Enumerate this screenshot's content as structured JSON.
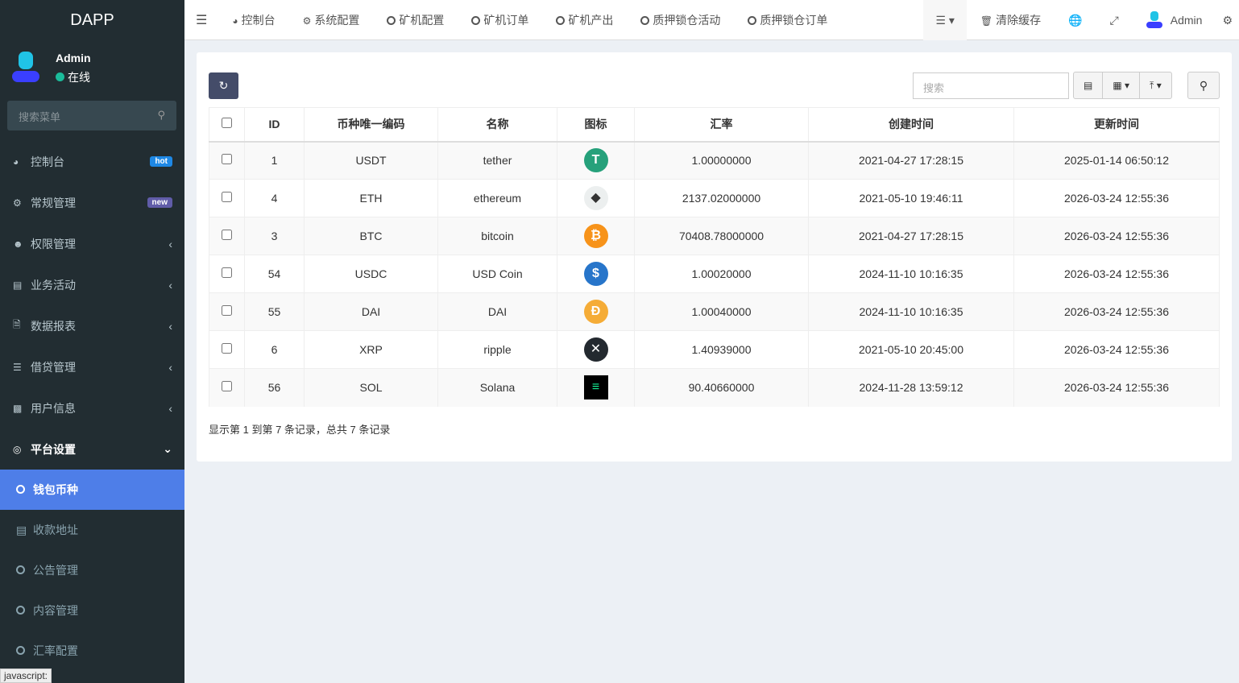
{
  "app": {
    "title": "DAPP",
    "user": "Admin",
    "status": "在线",
    "search_placeholder": "搜索菜单",
    "statusbar": "javascript:"
  },
  "sidebar": {
    "items": [
      {
        "label": "控制台",
        "icon": "dashboard-icon",
        "badge": "hot",
        "badge_color": "#1e88e5"
      },
      {
        "label": "常规管理",
        "icon": "cogs-icon",
        "badge": "new",
        "badge_color": "#605ca8"
      },
      {
        "label": "权限管理",
        "icon": "users-icon"
      },
      {
        "label": "业务活动",
        "icon": "list-alt-icon"
      },
      {
        "label": "数据报表",
        "icon": "file-icon"
      },
      {
        "label": "借贷管理",
        "icon": "list-icon"
      },
      {
        "label": "用户信息",
        "icon": "user-card-icon"
      },
      {
        "label": "平台设置",
        "icon": "dot-circle-icon"
      }
    ],
    "subitems": [
      "钱包币种",
      "收款地址",
      "公告管理",
      "内容管理",
      "汇率配置"
    ]
  },
  "topnav": {
    "items": [
      "控制台",
      "系统配置",
      "矿机配置",
      "矿机订单",
      "矿机产出",
      "质押锁仓活动",
      "质押锁仓订单"
    ],
    "clear_cache": "清除缓存",
    "user": "Admin"
  },
  "toolbar": {
    "search_placeholder": "搜索"
  },
  "table": {
    "columns": [
      "ID",
      "币种唯一编码",
      "名称",
      "图标",
      "汇率",
      "创建时间",
      "更新时间"
    ],
    "rows": [
      {
        "id": "1",
        "code": "USDT",
        "name": "tether",
        "icon": "tether",
        "rate": "1.00000000",
        "created": "2021-04-27 17:28:15",
        "updated": "2025-01-14 06:50:12"
      },
      {
        "id": "4",
        "code": "ETH",
        "name": "ethereum",
        "icon": "ethereum",
        "rate": "2137.02000000",
        "created": "2021-05-10 19:46:11",
        "updated": "2026-03-24 12:55:36"
      },
      {
        "id": "3",
        "code": "BTC",
        "name": "bitcoin",
        "icon": "bitcoin",
        "rate": "70408.78000000",
        "created": "2021-04-27 17:28:15",
        "updated": "2026-03-24 12:55:36"
      },
      {
        "id": "54",
        "code": "USDC",
        "name": "USD Coin",
        "icon": "usdc",
        "rate": "1.00020000",
        "created": "2024-11-10 10:16:35",
        "updated": "2026-03-24 12:55:36"
      },
      {
        "id": "55",
        "code": "DAI",
        "name": "DAI",
        "icon": "dai",
        "rate": "1.00040000",
        "created": "2024-11-10 10:16:35",
        "updated": "2026-03-24 12:55:36"
      },
      {
        "id": "6",
        "code": "XRP",
        "name": "ripple",
        "icon": "xrp",
        "rate": "1.40939000",
        "created": "2021-05-10 20:45:00",
        "updated": "2026-03-24 12:55:36"
      },
      {
        "id": "56",
        "code": "SOL",
        "name": "Solana",
        "icon": "solana",
        "rate": "90.40660000",
        "created": "2024-11-28 13:59:12",
        "updated": "2026-03-24 12:55:36"
      }
    ]
  },
  "footer": "显示第 1 到第 7 条记录，总共 7 条记录"
}
